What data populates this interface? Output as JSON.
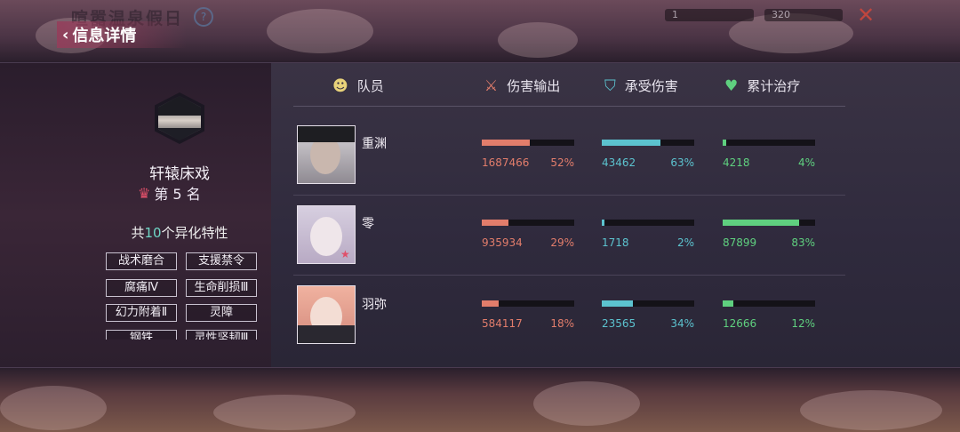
{
  "top_bar": {
    "event_title": "喧嚣温泉假日",
    "help": "?",
    "resource_1": "1",
    "resource_2": "320",
    "close": "✕"
  },
  "back_button": {
    "label": "信息详情"
  },
  "player": {
    "name": "轩辕床戏",
    "rank_label": "第 5 名",
    "trait_prefix": "共",
    "trait_count": "10",
    "trait_suffix": "个异化特性",
    "traits": [
      "战术磨合",
      "支援禁令",
      "腐痛Ⅳ",
      "生命削损Ⅲ",
      "幻力附着Ⅱ",
      "灵障",
      "钢铁",
      "灵性坚韧Ⅲ"
    ]
  },
  "table": {
    "headers": {
      "member": "队员",
      "damage": "伤害输出",
      "taken": "承受伤害",
      "heal": "累计治疗"
    },
    "rows": [
      {
        "name": "重渊",
        "damage": "1687466",
        "damage_pct": "52%",
        "damage_frac": 0.52,
        "taken": "43462",
        "taken_pct": "63%",
        "taken_frac": 0.63,
        "heal": "4218",
        "heal_pct": "4%",
        "heal_frac": 0.04
      },
      {
        "name": "零",
        "damage": "935934",
        "damage_pct": "29%",
        "damage_frac": 0.29,
        "taken": "1718",
        "taken_pct": "2%",
        "taken_frac": 0.02,
        "heal": "87899",
        "heal_pct": "83%",
        "heal_frac": 0.83
      },
      {
        "name": "羽弥",
        "damage": "584117",
        "damage_pct": "18%",
        "damage_frac": 0.18,
        "taken": "23565",
        "taken_pct": "34%",
        "taken_frac": 0.34,
        "heal": "12666",
        "heal_pct": "12%",
        "heal_frac": 0.12
      }
    ]
  },
  "colors": {
    "damage": "#e27d6b",
    "taken": "#5cc3cf",
    "heal": "#5fd07f",
    "accent": "#e0506a"
  },
  "icons": {
    "member": "user-icon",
    "damage": "crossed-swords-icon",
    "taken": "shield-icon",
    "heal": "heart-icon",
    "rank": "crown-icon"
  }
}
